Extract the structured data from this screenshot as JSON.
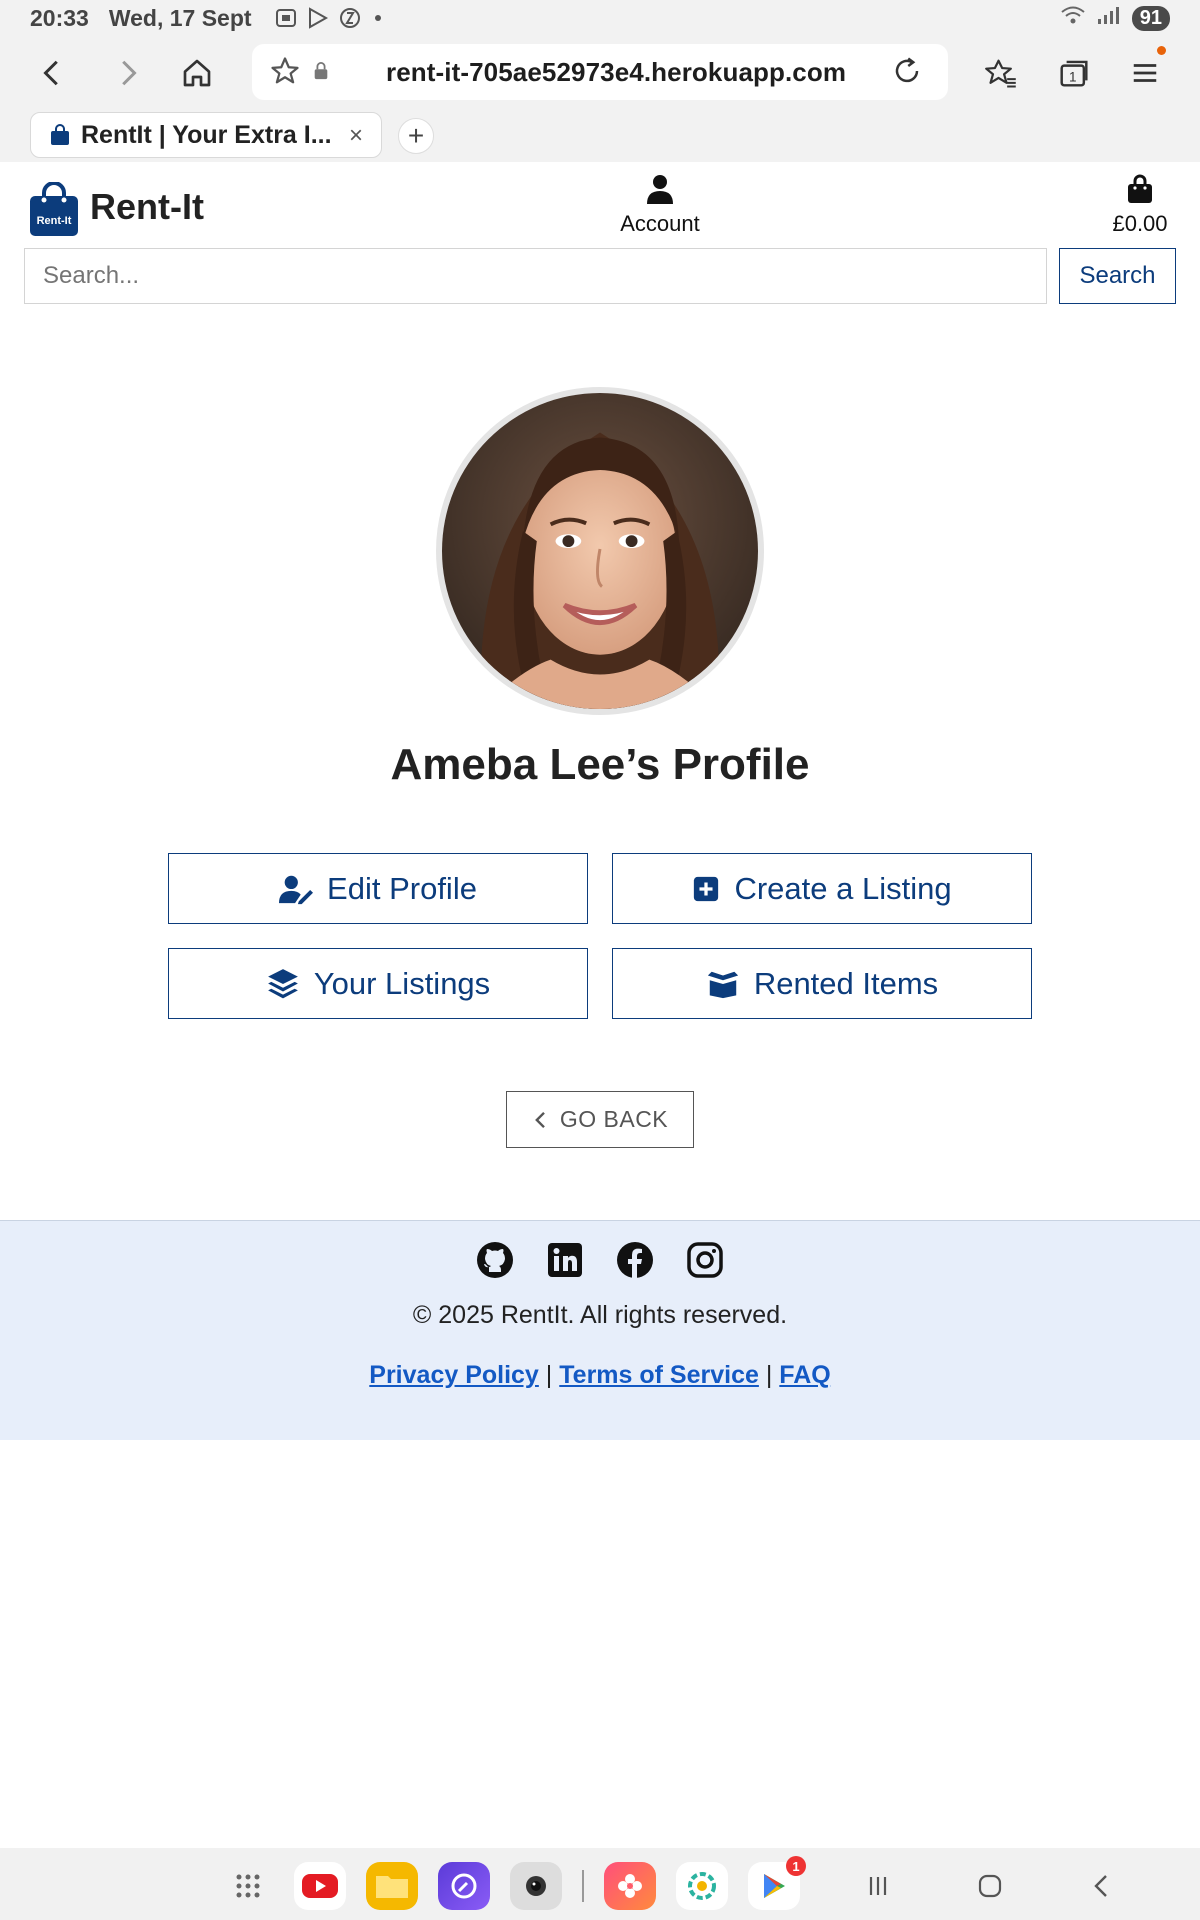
{
  "status_bar": {
    "time": "20:33",
    "date": "Wed, 17 Sept",
    "battery": "91"
  },
  "browser": {
    "url": "rent-it-705ae52973e4.herokuapp.com",
    "tab_title": "RentIt | Your Extra I...",
    "tab_close": "×",
    "new_tab": "+"
  },
  "header": {
    "brand": "Rent-It",
    "logo_text": "Rent-It",
    "account_label": "Account",
    "bag_total": "£0.00",
    "search_placeholder": "Search...",
    "search_button": "Search"
  },
  "profile": {
    "title": "Ameba Lee’s Profile",
    "actions": {
      "edit": "Edit Profile",
      "create": "Create a Listing",
      "listings": "Your Listings",
      "rented": "Rented Items"
    },
    "go_back": "GO BACK"
  },
  "footer": {
    "social_icons": [
      "github-icon",
      "linkedin-icon",
      "facebook-icon",
      "instagram-icon"
    ],
    "copyright": "© 2025 RentIt. All rights reserved.",
    "links": [
      "Privacy Policy",
      "Terms of Service",
      "FAQ"
    ],
    "separator": "|"
  },
  "navbar": {
    "play_badge": "1"
  },
  "colors": {
    "primary": "#0c3c7c",
    "link": "#1359c4",
    "footer_bg": "#e7eefa"
  }
}
